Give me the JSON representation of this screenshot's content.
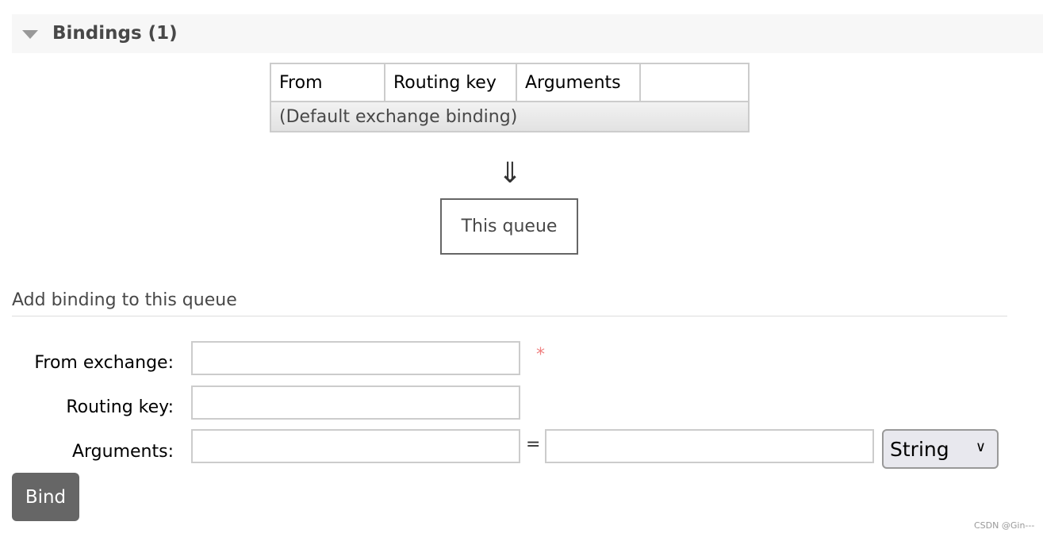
{
  "section": {
    "title": "Bindings (1)",
    "icon": "triangle-down-icon"
  },
  "table": {
    "headers": [
      "From",
      "Routing key",
      "Arguments",
      ""
    ],
    "rows": [
      [
        "(Default exchange binding)"
      ]
    ]
  },
  "flow": {
    "arrow": "⇓",
    "queue_label": "This queue"
  },
  "form": {
    "title": "Add binding to this queue",
    "from_exchange_label": "From exchange:",
    "from_exchange_value": "",
    "required_mark": "*",
    "routing_key_label": "Routing key:",
    "routing_key_value": "",
    "arguments_label": "Arguments:",
    "arg_key_value": "",
    "equals": "=",
    "arg_value_value": "",
    "type_selected": "String",
    "bind_button": "Bind"
  },
  "watermark": "CSDN @Gin---"
}
